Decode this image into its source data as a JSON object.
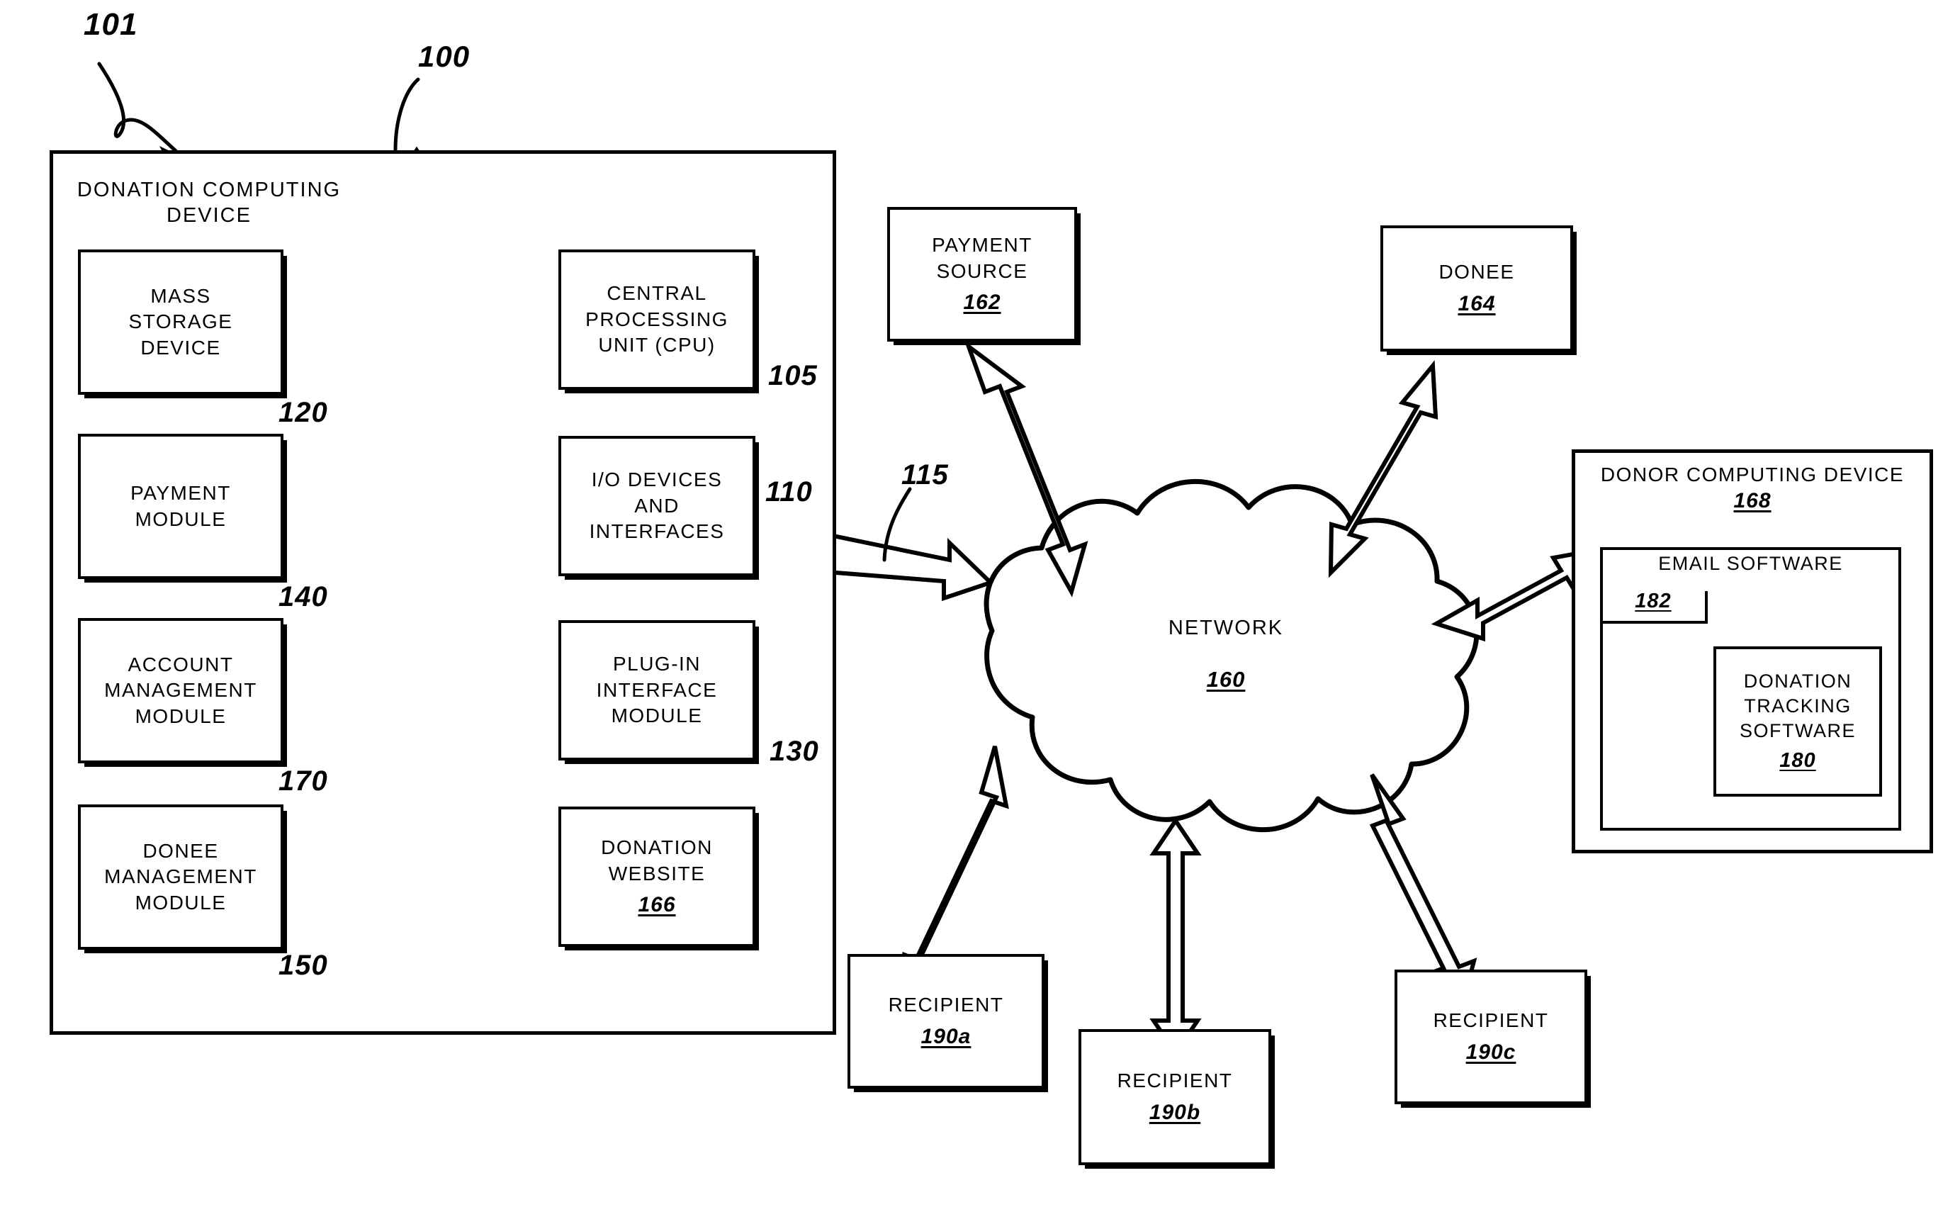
{
  "figure": {
    "system_ref": "101",
    "device_ref": "100",
    "bus_ref": "115"
  },
  "donation_device": {
    "title_line1": "DONATION COMPUTING",
    "title_line2": "DEVICE",
    "ref": "100",
    "left_modules": [
      {
        "lines": [
          "MASS",
          "STORAGE",
          "DEVICE"
        ],
        "ref": "120"
      },
      {
        "lines": [
          "PAYMENT",
          "MODULE"
        ],
        "ref": "140"
      },
      {
        "lines": [
          "ACCOUNT",
          "MANAGEMENT",
          "MODULE"
        ],
        "ref": "170"
      },
      {
        "lines": [
          "DONEE",
          "MANAGEMENT",
          "MODULE"
        ],
        "ref": "150"
      }
    ],
    "right_modules": [
      {
        "lines": [
          "CENTRAL",
          "PROCESSING",
          "UNIT  (CPU)"
        ],
        "ref": "105",
        "inline_ref": ""
      },
      {
        "lines": [
          "I/O  DEVICES",
          "AND",
          "INTERFACES"
        ],
        "ref": "110",
        "inline_ref": ""
      },
      {
        "lines": [
          "PLUG-IN",
          "INTERFACE",
          "MODULE"
        ],
        "ref": "130",
        "inline_ref": ""
      },
      {
        "lines": [
          "DONATION",
          "WEBSITE"
        ],
        "ref": "",
        "inline_ref": "166"
      }
    ]
  },
  "network": {
    "label": "NETWORK",
    "ref": "160"
  },
  "external_nodes": [
    {
      "name": "payment-source",
      "lines": [
        "PAYMENT",
        "SOURCE"
      ],
      "inline_ref": "162"
    },
    {
      "name": "donee",
      "lines": [
        "DONEE"
      ],
      "inline_ref": "164"
    },
    {
      "name": "recipient-a",
      "lines": [
        "RECIPIENT"
      ],
      "inline_ref": "190a"
    },
    {
      "name": "recipient-b",
      "lines": [
        "RECIPIENT"
      ],
      "inline_ref": "190b"
    },
    {
      "name": "recipient-c",
      "lines": [
        "RECIPIENT"
      ],
      "inline_ref": "190c"
    }
  ],
  "donor_device": {
    "title": "DONOR COMPUTING DEVICE",
    "ref": "168",
    "email_software": {
      "title": "EMAIL SOFTWARE",
      "ref": "182"
    },
    "tracking_software": {
      "lines": [
        "DONATION",
        "TRACKING",
        "SOFTWARE"
      ],
      "ref": "180"
    }
  }
}
